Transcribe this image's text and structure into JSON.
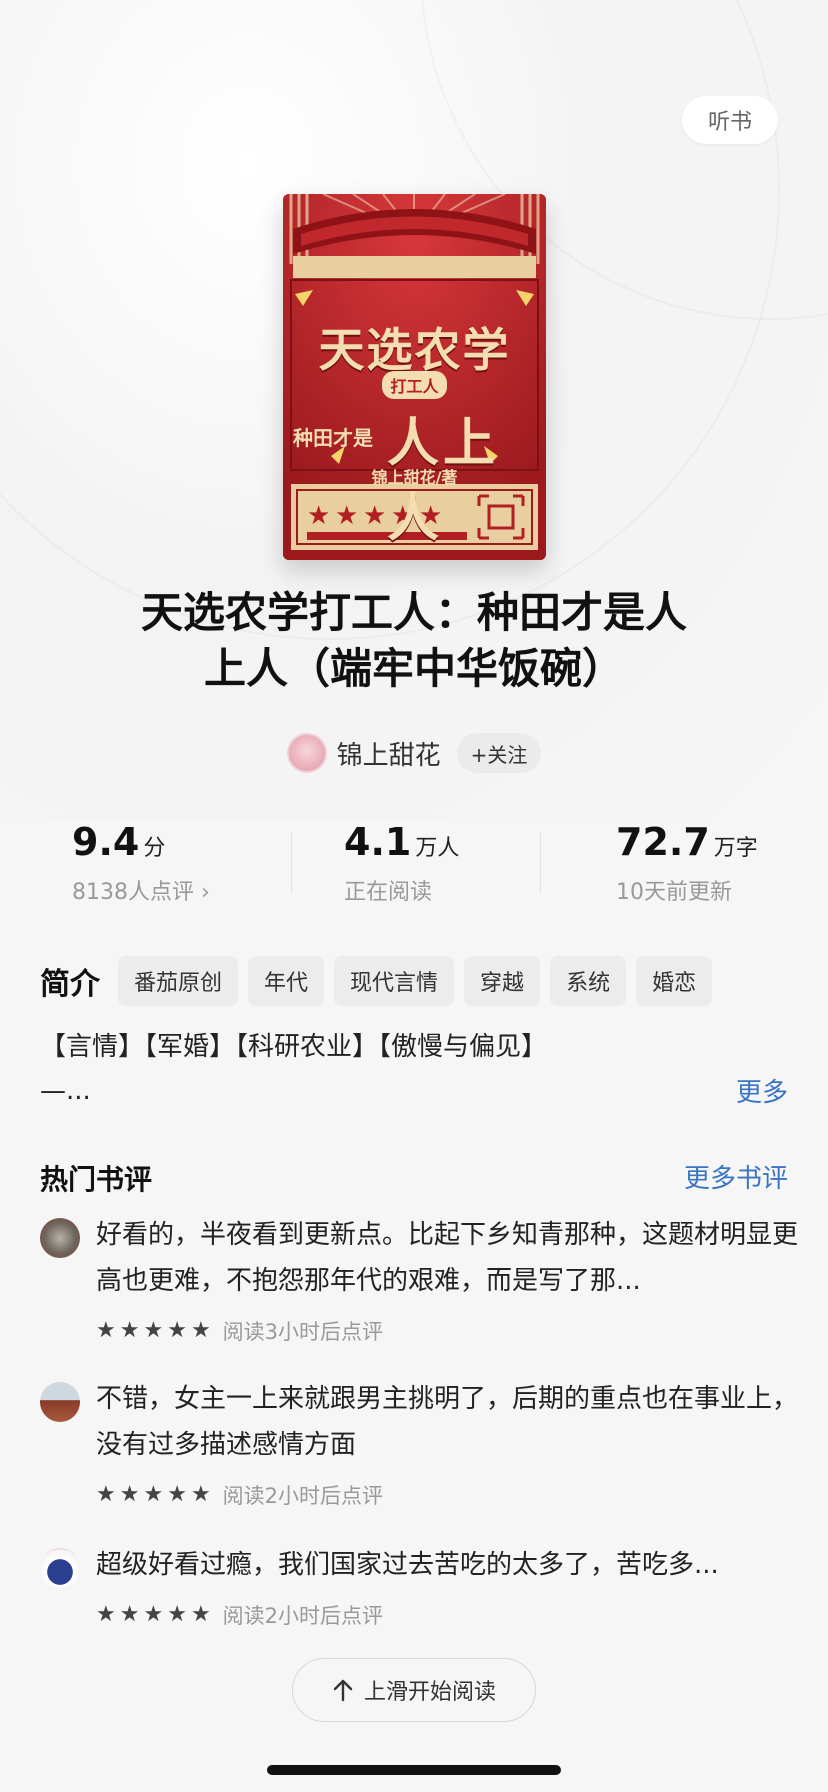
{
  "header": {
    "listen_label": "听书"
  },
  "cover": {
    "title_line1": "天选农学",
    "subtitle": "打工人",
    "left_text": "种田才是",
    "big_text": "人上人",
    "author_credit": "锦上甜花/著"
  },
  "book": {
    "title_line1": "天选农学打工人：种田才是人",
    "title_line2": "上人（端牢中华饭碗）"
  },
  "author": {
    "name": "锦上甜花",
    "follow_label": "+关注"
  },
  "stats": {
    "rating": {
      "value": "9.4",
      "unit": "分",
      "sub": "8138人点评 ›"
    },
    "readers": {
      "value": "4.1",
      "unit": "万人",
      "sub": "正在阅读"
    },
    "words": {
      "value": "72.7",
      "unit": "万字",
      "sub": "10天前更新"
    }
  },
  "intro": {
    "label": "简介",
    "tags": [
      "番茄原创",
      "年代",
      "现代言情",
      "穿越",
      "系统",
      "婚恋"
    ],
    "text_line1": "【言情】【军婚】【科研农业】【傲慢与偏见】",
    "text_line2": "—...",
    "more_label": "更多"
  },
  "reviews": {
    "title": "热门书评",
    "more_label": "更多书评",
    "items": [
      {
        "text": "好看的，半夜看到更新点。比起下乡知青那种，这题材明显更高也更难，不抱怨那年代的艰难，而是写了那...",
        "rating": 5,
        "meta": "阅读3小时后点评"
      },
      {
        "text": "不错，女主一上来就跟男主挑明了，后期的重点也在事业上，没有过多描述感情方面",
        "rating": 5,
        "meta": "阅读2小时后点评"
      },
      {
        "text": "超级好看过瘾，我们国家过去苦吃的太多了，苦吃多...",
        "rating": 5,
        "meta": "阅读2小时后点评"
      }
    ]
  },
  "footer": {
    "read_label": "上滑开始阅读",
    "arrow_icon": "arrow-up-icon"
  },
  "colors": {
    "accent_blue": "#3a74c4",
    "cover_red": "#b11f24",
    "cover_gold": "#f4ddb0"
  }
}
